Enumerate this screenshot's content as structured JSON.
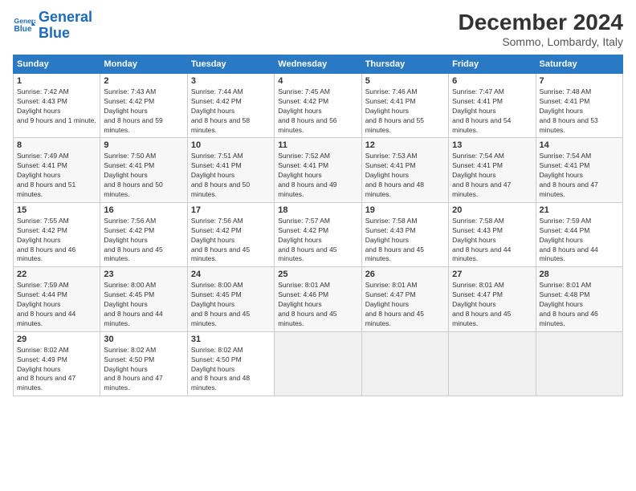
{
  "header": {
    "logo_general": "General",
    "logo_blue": "Blue",
    "month_title": "December 2024",
    "location": "Sommo, Lombardy, Italy"
  },
  "days_of_week": [
    "Sunday",
    "Monday",
    "Tuesday",
    "Wednesday",
    "Thursday",
    "Friday",
    "Saturday"
  ],
  "weeks": [
    [
      {
        "num": "1",
        "sunrise": "7:42 AM",
        "sunset": "4:43 PM",
        "daylight": "9 hours and 1 minute."
      },
      {
        "num": "2",
        "sunrise": "7:43 AM",
        "sunset": "4:42 PM",
        "daylight": "8 hours and 59 minutes."
      },
      {
        "num": "3",
        "sunrise": "7:44 AM",
        "sunset": "4:42 PM",
        "daylight": "8 hours and 58 minutes."
      },
      {
        "num": "4",
        "sunrise": "7:45 AM",
        "sunset": "4:42 PM",
        "daylight": "8 hours and 56 minutes."
      },
      {
        "num": "5",
        "sunrise": "7:46 AM",
        "sunset": "4:41 PM",
        "daylight": "8 hours and 55 minutes."
      },
      {
        "num": "6",
        "sunrise": "7:47 AM",
        "sunset": "4:41 PM",
        "daylight": "8 hours and 54 minutes."
      },
      {
        "num": "7",
        "sunrise": "7:48 AM",
        "sunset": "4:41 PM",
        "daylight": "8 hours and 53 minutes."
      }
    ],
    [
      {
        "num": "8",
        "sunrise": "7:49 AM",
        "sunset": "4:41 PM",
        "daylight": "8 hours and 51 minutes."
      },
      {
        "num": "9",
        "sunrise": "7:50 AM",
        "sunset": "4:41 PM",
        "daylight": "8 hours and 50 minutes."
      },
      {
        "num": "10",
        "sunrise": "7:51 AM",
        "sunset": "4:41 PM",
        "daylight": "8 hours and 50 minutes."
      },
      {
        "num": "11",
        "sunrise": "7:52 AM",
        "sunset": "4:41 PM",
        "daylight": "8 hours and 49 minutes."
      },
      {
        "num": "12",
        "sunrise": "7:53 AM",
        "sunset": "4:41 PM",
        "daylight": "8 hours and 48 minutes."
      },
      {
        "num": "13",
        "sunrise": "7:54 AM",
        "sunset": "4:41 PM",
        "daylight": "8 hours and 47 minutes."
      },
      {
        "num": "14",
        "sunrise": "7:54 AM",
        "sunset": "4:41 PM",
        "daylight": "8 hours and 47 minutes."
      }
    ],
    [
      {
        "num": "15",
        "sunrise": "7:55 AM",
        "sunset": "4:42 PM",
        "daylight": "8 hours and 46 minutes."
      },
      {
        "num": "16",
        "sunrise": "7:56 AM",
        "sunset": "4:42 PM",
        "daylight": "8 hours and 45 minutes."
      },
      {
        "num": "17",
        "sunrise": "7:56 AM",
        "sunset": "4:42 PM",
        "daylight": "8 hours and 45 minutes."
      },
      {
        "num": "18",
        "sunrise": "7:57 AM",
        "sunset": "4:42 PM",
        "daylight": "8 hours and 45 minutes."
      },
      {
        "num": "19",
        "sunrise": "7:58 AM",
        "sunset": "4:43 PM",
        "daylight": "8 hours and 45 minutes."
      },
      {
        "num": "20",
        "sunrise": "7:58 AM",
        "sunset": "4:43 PM",
        "daylight": "8 hours and 44 minutes."
      },
      {
        "num": "21",
        "sunrise": "7:59 AM",
        "sunset": "4:44 PM",
        "daylight": "8 hours and 44 minutes."
      }
    ],
    [
      {
        "num": "22",
        "sunrise": "7:59 AM",
        "sunset": "4:44 PM",
        "daylight": "8 hours and 44 minutes."
      },
      {
        "num": "23",
        "sunrise": "8:00 AM",
        "sunset": "4:45 PM",
        "daylight": "8 hours and 44 minutes."
      },
      {
        "num": "24",
        "sunrise": "8:00 AM",
        "sunset": "4:45 PM",
        "daylight": "8 hours and 45 minutes."
      },
      {
        "num": "25",
        "sunrise": "8:01 AM",
        "sunset": "4:46 PM",
        "daylight": "8 hours and 45 minutes."
      },
      {
        "num": "26",
        "sunrise": "8:01 AM",
        "sunset": "4:47 PM",
        "daylight": "8 hours and 45 minutes."
      },
      {
        "num": "27",
        "sunrise": "8:01 AM",
        "sunset": "4:47 PM",
        "daylight": "8 hours and 45 minutes."
      },
      {
        "num": "28",
        "sunrise": "8:01 AM",
        "sunset": "4:48 PM",
        "daylight": "8 hours and 46 minutes."
      }
    ],
    [
      {
        "num": "29",
        "sunrise": "8:02 AM",
        "sunset": "4:49 PM",
        "daylight": "8 hours and 47 minutes."
      },
      {
        "num": "30",
        "sunrise": "8:02 AM",
        "sunset": "4:50 PM",
        "daylight": "8 hours and 47 minutes."
      },
      {
        "num": "31",
        "sunrise": "8:02 AM",
        "sunset": "4:50 PM",
        "daylight": "8 hours and 48 minutes."
      },
      null,
      null,
      null,
      null
    ]
  ]
}
